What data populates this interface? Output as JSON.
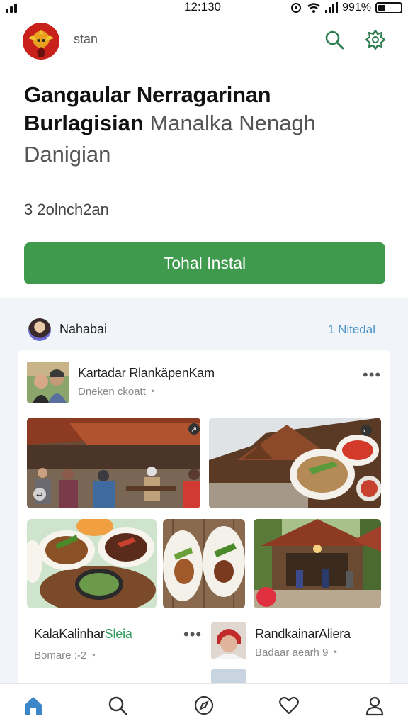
{
  "status_bar": {
    "time": "12:130",
    "battery": "991%"
  },
  "header": {
    "label": "stan",
    "icons": [
      "app-logo",
      "search-icon",
      "settings-icon"
    ]
  },
  "app": {
    "title_line1": "Gangaular Nerragarinan",
    "title_line2_bold": "Burlagisian",
    "title_line2_light": "Manalka Nenagh",
    "title_line3": "Danigian",
    "subtitle": "3  2olnch2an",
    "install_label": "Tohal Instal",
    "accent_color": "#3f9a4e"
  },
  "feed": {
    "title": "Nahabai",
    "link": "1 Nitedal",
    "post": {
      "title": "Kartadar RlankäpenKam",
      "subtitle": "Dneken ckoatt"
    },
    "items": [
      {
        "title_main": "KalaKalinhar",
        "title_accent": "Sleia",
        "meta": "Bomare :-2"
      },
      {
        "title": "RandkainarAliera",
        "meta": "Badaar aearh 9"
      }
    ]
  },
  "bottom_nav": {
    "items": [
      "home-icon",
      "search-icon",
      "explore-icon",
      "heart-icon",
      "profile-icon"
    ],
    "active": "home-icon"
  }
}
